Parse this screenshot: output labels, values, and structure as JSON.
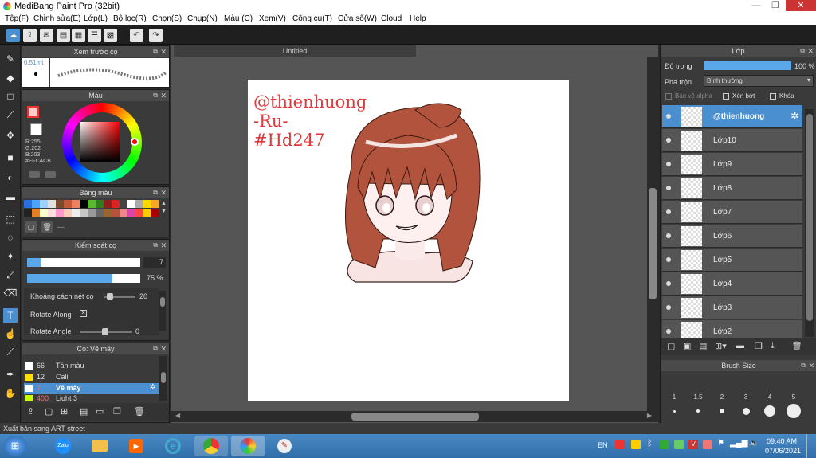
{
  "app": {
    "title": "MediBang Paint Pro (32bit)"
  },
  "menu": [
    "Tệp(F)",
    "Chỉnh sửa(E)",
    "Lớp(L)",
    "Bộ lọc(R)",
    "Chọn(S)",
    "Chụp(N)",
    "Màu (C)",
    "Xem(V)",
    "Công cụ(T)",
    "Cửa sổ(W)",
    "Cloud",
    "Help"
  ],
  "document": {
    "tab": "Untitled",
    "text_lines": [
      "@thienhuong",
      "-Ru-",
      "#Hd247"
    ]
  },
  "brush_preview": {
    "title": "Xem trước cọ",
    "size": "0.51mt"
  },
  "color_panel": {
    "title": "Màu",
    "r": "R:255",
    "g": "G:202",
    "b": "B:203",
    "hex": "#FFCACB",
    "current": "#FFCACB"
  },
  "palette": {
    "title": "Bảng màu",
    "dash": "---",
    "colors": [
      "#2a6de0",
      "#4aa3ff",
      "#9cd1ff",
      "#e0e0e0",
      "#7a4a2a",
      "#c05a3a",
      "#f08060",
      "#000000",
      "#58b830",
      "#2e7e1e",
      "#8a2020",
      "#d22",
      "#444",
      "#fff",
      "#aaa",
      "#ffd700",
      "#f5a623",
      "#222",
      "#e67e22",
      "#ffc",
      "#fdd",
      "#f9c",
      "#fcb",
      "#eee",
      "#c7c7c7",
      "#999",
      "#666",
      "#963",
      "#b5523b",
      "#e88",
      "#d4a",
      "#f44",
      "#ffcc00",
      "#a00"
    ]
  },
  "brush_control": {
    "title": "Kiểm soát cọ",
    "size_value": "7",
    "opacity_value": "75 %",
    "spacing_label": "Khoảng cách nét cọ",
    "spacing_value": "20",
    "rotate_along": "Rotate Along",
    "rotate_angle": "Rotate Angle",
    "rotate_angle_value": "0"
  },
  "brush_list": {
    "title": "Cọ: Vẽ mây",
    "items": [
      {
        "size": "66",
        "name": "Tán màu",
        "color": "#ffffff"
      },
      {
        "size": "12",
        "name": "Cali",
        "color": "#ffe000"
      },
      {
        "size": "7",
        "name": "Vẽ mây",
        "color": "#ffffff"
      },
      {
        "size": "400",
        "name": "Light 3",
        "color": "#c6ff00"
      }
    ]
  },
  "layers_panel": {
    "title": "Lớp",
    "opacity_label": "Độ trong",
    "opacity_value": "100 %",
    "blend_label": "Pha trộn",
    "blend_value": "Bình thường",
    "protect_alpha": "Bảo vệ alpha",
    "clipping": "Xén bớt",
    "lock": "Khóa",
    "layers": [
      "@thienhuong",
      "Lớp10",
      "Lớp9",
      "Lớp8",
      "Lớp7",
      "Lớp6",
      "Lớp5",
      "Lớp4",
      "Lớp3",
      "Lớp2"
    ]
  },
  "brush_size": {
    "title": "Brush Size",
    "sizes": [
      "1",
      "1.5",
      "2",
      "3",
      "4",
      "5"
    ]
  },
  "status": {
    "text": "Xuất bản sang ART street"
  },
  "taskbar": {
    "lang": "EN",
    "time": "09:40 AM",
    "date": "07/06/2021",
    "zalo": "Zalo"
  },
  "colors": {
    "accent": "#4a8fd0",
    "signature": "#e0393b",
    "hair": "#b2533e"
  }
}
